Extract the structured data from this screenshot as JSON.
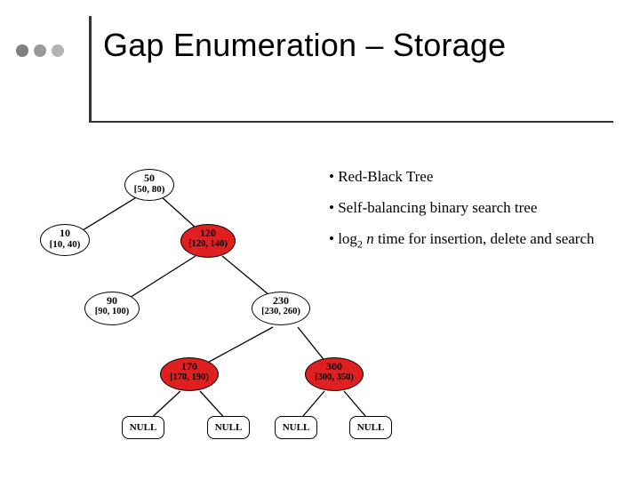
{
  "title": "Gap Enumeration – Storage",
  "bullets": {
    "b1": "• Red-Black Tree",
    "b2": "• Self-balancing binary search tree",
    "b3_pre": "• log",
    "b3_sub": "2",
    "b3_mid": " ",
    "b3_var": "n",
    "b3_post": " time for insertion, delete and search"
  },
  "nodes": {
    "n50": {
      "l1": "50",
      "l2": "[50, 80)"
    },
    "n10": {
      "l1": "10",
      "l2": "[10, 40)"
    },
    "n120": {
      "l1": "120",
      "l2": "[120, 140)"
    },
    "n90": {
      "l1": "90",
      "l2": "[90, 100)"
    },
    "n230": {
      "l1": "230",
      "l2": "[230, 260)"
    },
    "n170": {
      "l1": "170",
      "l2": "[170, 190)"
    },
    "n300": {
      "l1": "300",
      "l2": "[300, 350)"
    },
    "null": "NULL"
  }
}
